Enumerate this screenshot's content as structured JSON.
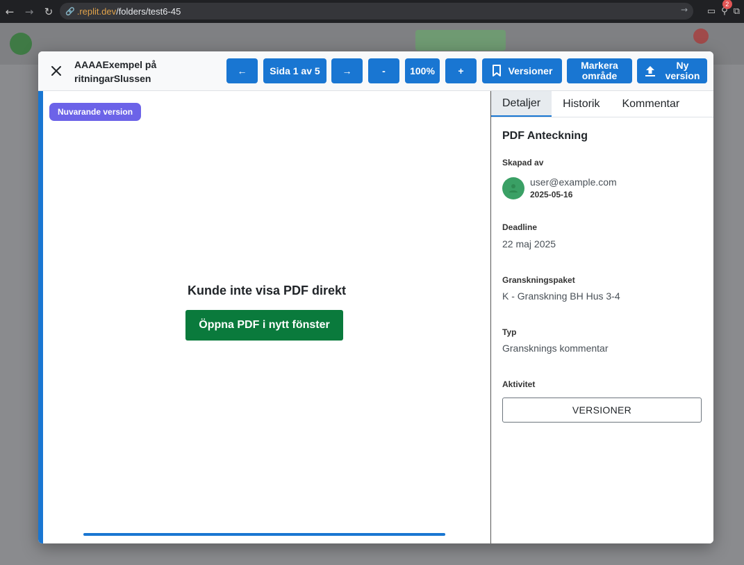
{
  "browser": {
    "url_host": ".replit.dev",
    "url_path": "/folders/test6-45",
    "extension_badge": "2"
  },
  "modal": {
    "title": "AAAAExempel på ritningarSlussen",
    "toolbar": {
      "prev_label": "←",
      "page_label": "Sida 1 av 5",
      "next_label": "→",
      "zoom_out_label": "-",
      "zoom_label": "100%",
      "zoom_in_label": "+",
      "versions_label": "Versioner",
      "mark_area_label": "Markera område",
      "new_version_label": "Ny version"
    },
    "viewer": {
      "version_badge": "Nuvarande version",
      "message": "Kunde inte visa PDF direkt",
      "open_button": "Öppna PDF i nytt fönster"
    },
    "panel": {
      "tabs": [
        "Detaljer",
        "Historik",
        "Kommentar"
      ],
      "active_tab": "Detaljer",
      "section_title": "PDF Anteckning",
      "created_by_label": "Skapad av",
      "creator_email": "user@example.com",
      "creator_date": "2025-05-16",
      "deadline_label": "Deadline",
      "deadline_value": "22 maj 2025",
      "package_label": "Granskningspaket",
      "package_value": "K - Granskning BH Hus 3-4",
      "type_label": "Typ",
      "type_value": "Gransknings kommentar",
      "activity_label": "Aktivitet",
      "activity_button": "VERSIONER"
    }
  },
  "colors": {
    "primary": "#1976d2",
    "badge": "#6c63e8",
    "open_button": "#0a7a3c",
    "avatar": "#3aa065"
  }
}
